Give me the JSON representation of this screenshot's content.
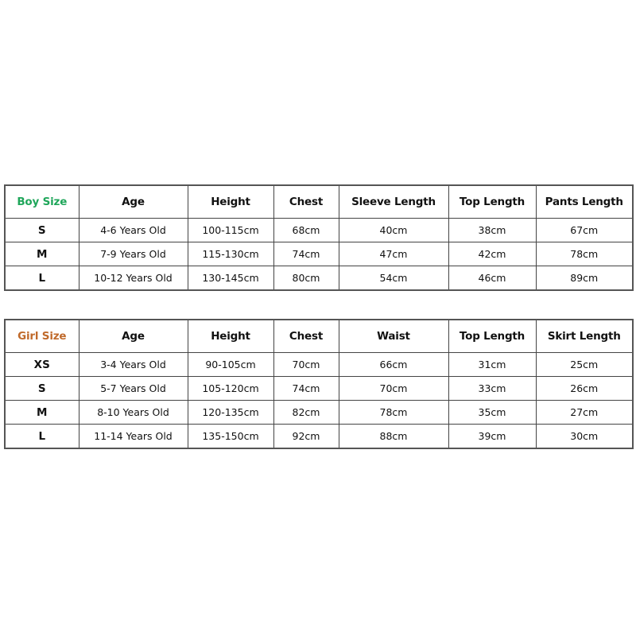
{
  "boy_table": {
    "headers": [
      "Boy Size",
      "Age",
      "Height",
      "Chest",
      "Sleeve Length",
      "Top Length",
      "Pants Length"
    ],
    "header_color": "#1fa65a",
    "rows": [
      [
        "S",
        "4-6 Years Old",
        "100-115cm",
        "68cm",
        "40cm",
        "38cm",
        "67cm"
      ],
      [
        "M",
        "7-9 Years Old",
        "115-130cm",
        "74cm",
        "47cm",
        "42cm",
        "78cm"
      ],
      [
        "L",
        "10-12 Years Old",
        "130-145cm",
        "80cm",
        "54cm",
        "46cm",
        "89cm"
      ]
    ]
  },
  "girl_table": {
    "headers": [
      "Girl Size",
      "Age",
      "Height",
      "Chest",
      "Waist",
      "Top Length",
      "Skirt Length"
    ],
    "header_color": "#c06a2b",
    "rows": [
      [
        "XS",
        "3-4 Years Old",
        "90-105cm",
        "70cm",
        "66cm",
        "31cm",
        "25cm"
      ],
      [
        "S",
        "5-7 Years Old",
        "105-120cm",
        "74cm",
        "70cm",
        "33cm",
        "26cm"
      ],
      [
        "M",
        "8-10 Years Old",
        "120-135cm",
        "82cm",
        "78cm",
        "35cm",
        "27cm"
      ],
      [
        "L",
        "11-14 Years Old",
        "135-150cm",
        "92cm",
        "88cm",
        "39cm",
        "30cm"
      ]
    ]
  }
}
